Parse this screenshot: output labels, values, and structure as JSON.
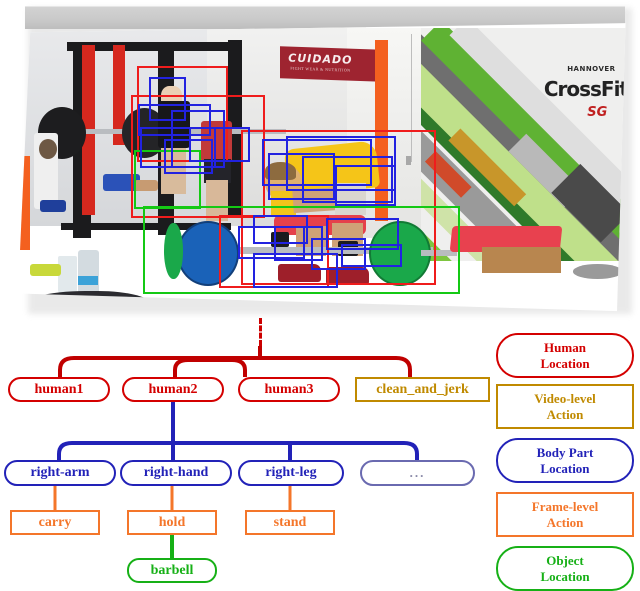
{
  "figure": {
    "kind": "hierarchical-annotation-diagram",
    "photo": {
      "scene_description": "CrossFit gym, athlete in yellow shirt lifting a barbell",
      "wall_texts": [
        "CUIDADO",
        "HANNOVER",
        "CrossFit",
        "SG"
      ],
      "boxes": [
        {
          "label": "human1",
          "color": "#ef1c1c",
          "type": "human"
        },
        {
          "label": "human2",
          "color": "#ef1c1c",
          "type": "human"
        },
        {
          "label": "human3",
          "color": "#ef1c1c",
          "type": "human"
        },
        {
          "label": "body-part",
          "color": "#2222e0",
          "type": "body-part"
        },
        {
          "label": "object",
          "color": "#14c914",
          "type": "object"
        }
      ]
    }
  },
  "tree": {
    "level_human": [
      {
        "id": "human1",
        "label": "human1",
        "style": "human"
      },
      {
        "id": "human2",
        "label": "human2",
        "style": "human"
      },
      {
        "id": "human3",
        "label": "human3",
        "style": "human"
      },
      {
        "id": "clean_and_jerk",
        "label": "clean_and_jerk",
        "style": "video"
      }
    ],
    "level_bodypart": [
      {
        "id": "right-arm",
        "label": "right-arm",
        "style": "body"
      },
      {
        "id": "right-hand",
        "label": "right-hand",
        "style": "body"
      },
      {
        "id": "right-leg",
        "label": "right-leg",
        "style": "body"
      },
      {
        "id": "more",
        "label": "...",
        "style": "body-ellipsis"
      }
    ],
    "level_action": [
      {
        "id": "carry",
        "label": "carry",
        "style": "action"
      },
      {
        "id": "hold",
        "label": "hold",
        "style": "action"
      },
      {
        "id": "stand",
        "label": "stand",
        "style": "action"
      }
    ],
    "level_object": [
      {
        "id": "barbell",
        "label": "barbell",
        "style": "object"
      }
    ]
  },
  "legend": {
    "items": [
      {
        "id": "human-location",
        "line1": "Human",
        "line2": "Location",
        "color": "#d40000",
        "shape": "rounded"
      },
      {
        "id": "video-level-action",
        "line1": "Video-level",
        "line2": "Action",
        "color": "#c08a00",
        "shape": "rect"
      },
      {
        "id": "body-part-location",
        "line1": "Body Part",
        "line2": "Location",
        "color": "#2222b8",
        "shape": "rounded"
      },
      {
        "id": "frame-level-action",
        "line1": "Frame-level",
        "line2": "Action",
        "color": "#f4762a",
        "shape": "rect"
      },
      {
        "id": "object-location",
        "line1": "Object",
        "line2": "Location",
        "color": "#16b016",
        "shape": "rounded"
      }
    ]
  },
  "colors": {
    "human": "#d40000",
    "video_action": "#c08a00",
    "body_part": "#2222b8",
    "frame_action": "#f4762a",
    "object": "#16b016"
  }
}
